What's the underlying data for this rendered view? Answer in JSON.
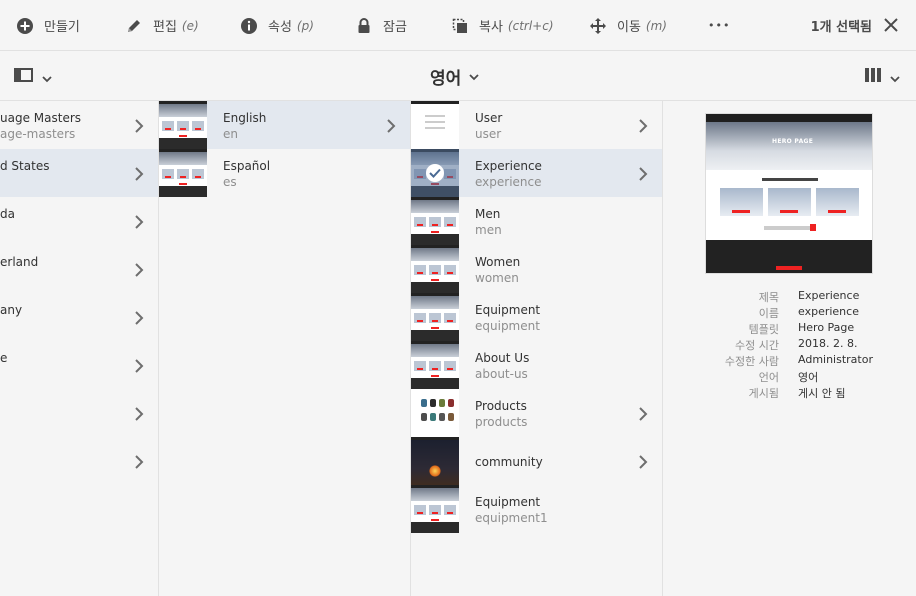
{
  "actionbar": {
    "create": "만들기",
    "edit": "편집",
    "edit_shortcut": "(e)",
    "properties": "속성",
    "properties_shortcut": "(p)",
    "lock": "잠금",
    "copy": "복사",
    "copy_shortcut": "(ctrl+c)",
    "move": "이동",
    "move_shortcut": "(m)",
    "more": "•••",
    "selection_count": "1개 선택됨"
  },
  "viewbar": {
    "title": "영어"
  },
  "column1": {
    "items": [
      {
        "title": "uage Masters",
        "name": "age-masters"
      },
      {
        "title": "d States",
        "name": ""
      },
      {
        "title": "da",
        "name": ""
      },
      {
        "title": "erland",
        "name": ""
      },
      {
        "title": "any",
        "name": ""
      },
      {
        "title": "e",
        "name": ""
      },
      {
        "title": "",
        "name": ""
      },
      {
        "title": "",
        "name": ""
      }
    ]
  },
  "column2": {
    "items": [
      {
        "title": "English",
        "name": "en"
      },
      {
        "title": "Español",
        "name": "es"
      }
    ]
  },
  "column3": {
    "items": [
      {
        "title": "User",
        "name": "user"
      },
      {
        "title": "Experience",
        "name": "experience"
      },
      {
        "title": "Men",
        "name": "men"
      },
      {
        "title": "Women",
        "name": "women"
      },
      {
        "title": "Equipment",
        "name": "equipment"
      },
      {
        "title": "About Us",
        "name": "about-us"
      },
      {
        "title": "Products",
        "name": "products"
      },
      {
        "title": "community",
        "name": ""
      },
      {
        "title": "Equipment",
        "name": "equipment1"
      }
    ]
  },
  "preview": {
    "hero_text": "HERO PAGE",
    "labels": {
      "title": "제목",
      "name": "이름",
      "template": "템플릿",
      "modified": "수정 시간",
      "modified_by": "수정한 사람",
      "language": "언어",
      "published": "게시됨"
    },
    "values": {
      "title": "Experience",
      "name": "experience",
      "template": "Hero Page",
      "modified": "2018. 2. 8.",
      "modified_by": "Administrator",
      "language": "영어",
      "published": "게시 안 됨"
    }
  },
  "colors": {
    "background": "#f5f5f5",
    "active_row": "#e3e8ef",
    "text_primary": "#323232",
    "text_secondary": "#8e8e8e",
    "accent_red": "#e22222"
  }
}
